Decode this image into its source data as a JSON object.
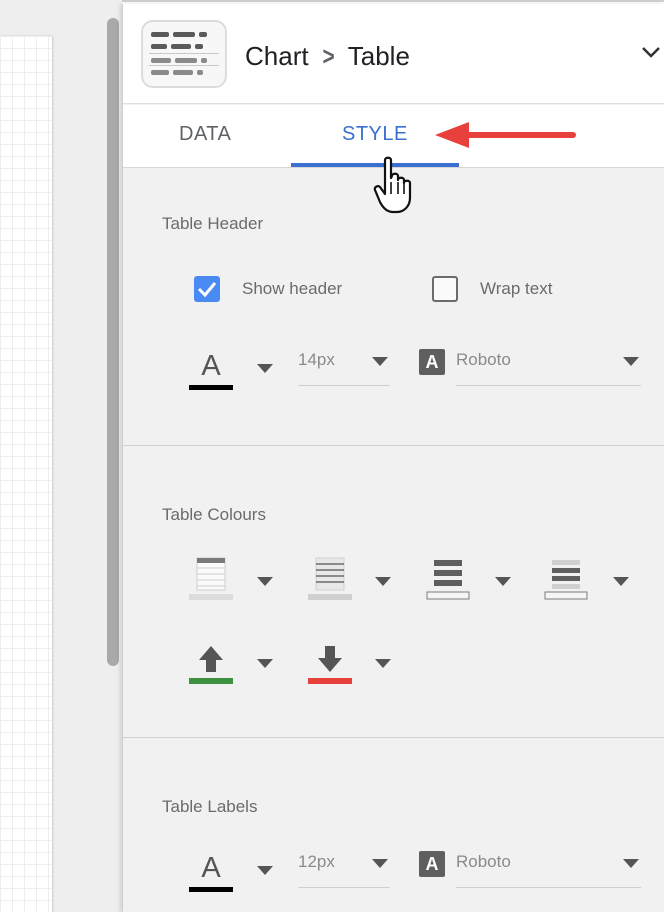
{
  "panel": {
    "breadcrumb": {
      "chart_label": "Chart",
      "separator": ">",
      "type_label": "Table"
    },
    "icons": {
      "chart_type_icon": "table-chart-icon",
      "collapse_icon": "chevron-down-icon"
    },
    "tabs": [
      {
        "label": "DATA",
        "active": false
      },
      {
        "label": "STYLE",
        "active": true
      }
    ],
    "accent_color": "#3b6fd0"
  },
  "table_header": {
    "title": "Table Header",
    "show_header": {
      "label": "Show header",
      "checked": true
    },
    "wrap_text": {
      "label": "Wrap text",
      "checked": false
    },
    "font_color_icon": "font-color-icon",
    "font_color": "#000000",
    "font_size": "14px",
    "font_family_icon_letter": "A",
    "font_family": "Roboto"
  },
  "table_colours": {
    "title": "Table Colours",
    "icons": [
      "header-background-icon",
      "table-cell-background-icon",
      "border-color-icon",
      "odd-row-color-icon",
      "positive-arrow-color-icon",
      "negative-arrow-color-icon"
    ],
    "positive_color": "#3d9140",
    "negative_color": "#e8403a"
  },
  "table_labels": {
    "title": "Table Labels",
    "font_color_icon": "font-color-icon",
    "font_color": "#000000",
    "font_size": "12px",
    "font_family_icon_letter": "A",
    "font_family": "Roboto"
  },
  "annotation": {
    "arrow_color": "#e8403a"
  }
}
